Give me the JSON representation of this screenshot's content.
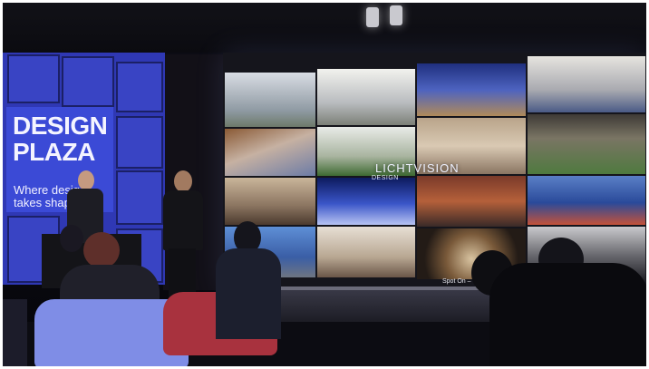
{
  "photo": {
    "description_free": true
  },
  "sign": {
    "line1": "DESIGN",
    "line2": "PLAZA",
    "tagline1": "Where desig",
    "tagline2": "takes shap"
  },
  "screen": {
    "logo": "LICHTVISION",
    "sublabel": "DESIGN",
    "footer": "Spot On –"
  },
  "colors": {
    "sign_blue": "#3b4ad6",
    "wall_blue": "#2f38b4",
    "chair_blue": "#7f8de6",
    "chair_red": "#a8323e"
  }
}
